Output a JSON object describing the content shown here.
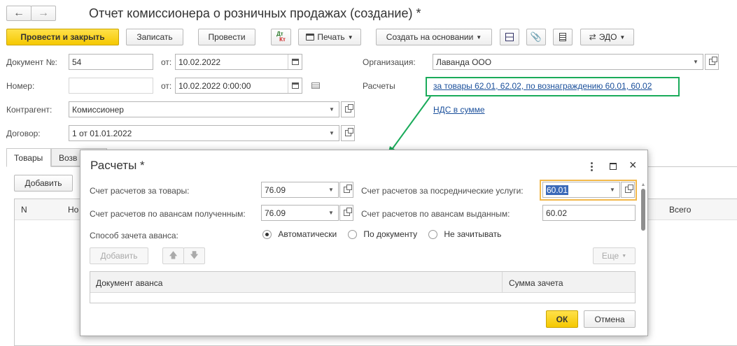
{
  "header": {
    "title": "Отчет комиссионера о розничных продажах (создание) *"
  },
  "toolbar": {
    "post_close": "Провести и закрыть",
    "save": "Записать",
    "post": "Провести",
    "dt_kt_top": "Дт",
    "dt_kt_bottom": "Кт",
    "print": "Печать",
    "create_based": "Создать на основании",
    "edo": "ЭДО"
  },
  "form": {
    "doc_no_label": "Документ №:",
    "doc_no": "54",
    "from_label": "от:",
    "doc_date": "10.02.2022",
    "number_label": "Номер:",
    "number_value": "",
    "from2_label": "от:",
    "datetime": "10.02.2022  0:00:00",
    "counterparty_label": "Контрагент:",
    "counterparty": "Комиссионер",
    "contract_label": "Договор:",
    "contract": "1 от 01.01.2022",
    "org_label": "Организация:",
    "org": "Лаванда ООО",
    "settlements_label": "Расчеты",
    "settlements_link": "за товары 62.01, 62.02, по вознаграждению 60.01, 60.02",
    "vat_link": "НДС в сумме"
  },
  "tabs": [
    "Товары",
    "Возв"
  ],
  "table": {
    "add": "Добавить",
    "col_n": "N",
    "col_name": "Но",
    "col_total": "Всего"
  },
  "colors": {
    "highlight": "#1aab5a",
    "focus": "#f2b84a",
    "accent": "#f5c800"
  },
  "dialog": {
    "title": "Расчеты *",
    "goods_label": "Счет расчетов за товары:",
    "goods_value": "76.09",
    "agency_label": "Счет расчетов за посреднические услуги:",
    "agency_value": "60.01",
    "adv_recv_label": "Счет расчетов по авансам полученным:",
    "adv_recv_value": "76.09",
    "adv_paid_label": "Счет расчетов по авансам выданным:",
    "adv_paid_value": "60.02",
    "offset_label": "Способ зачета аванса:",
    "radio_auto": "Автоматически",
    "radio_doc": "По документу",
    "radio_none": "Не зачитывать",
    "add": "Добавить",
    "more": "Еще",
    "col_doc": "Документ аванса",
    "col_sum": "Сумма зачета",
    "ok": "ОК",
    "cancel": "Отмена"
  }
}
